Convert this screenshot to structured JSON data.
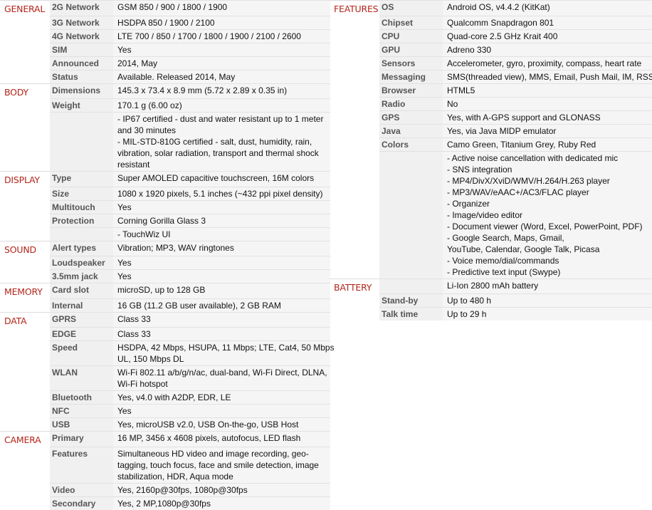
{
  "left": [
    {
      "category": "GENERAL",
      "rows": [
        {
          "name": "2G Network",
          "value": [
            "GSM 850 / 900 / 1800 / 1900"
          ]
        },
        {
          "name": "3G Network",
          "value": [
            "HSDPA 850 / 1900 / 2100"
          ]
        },
        {
          "name": "4G Network",
          "value": [
            "LTE 700 / 850 / 1700 / 1800 / 1900 / 2100 / 2600"
          ]
        },
        {
          "name": "SIM",
          "value": [
            "Yes"
          ]
        },
        {
          "name": "Announced",
          "value": [
            "2014, May"
          ]
        },
        {
          "name": "Status",
          "value": [
            "Available. Released 2014, May"
          ]
        }
      ]
    },
    {
      "category": "BODY",
      "rows": [
        {
          "name": "Dimensions",
          "value": [
            "145.3 x 73.4 x 8.9 mm (5.72 x 2.89 x 0.35 in)"
          ]
        },
        {
          "name": "Weight",
          "value": [
            "170.1 g (6.00 oz)"
          ]
        },
        {
          "name": "",
          "value": [
            "- IP67 certified - dust and water resistant up to 1 meter",
            "and 30 minutes",
            "- MIL-STD-810G certified - salt, dust, humidity, rain,",
            "vibration, solar radiation, transport and thermal shock",
            "resistant"
          ]
        }
      ]
    },
    {
      "category": "DISPLAY",
      "rows": [
        {
          "name": "Type",
          "value": [
            "Super AMOLED capacitive touchscreen, 16M colors"
          ]
        },
        {
          "name": "Size",
          "value": [
            "1080 x 1920 pixels, 5.1 inches (~432 ppi pixel density)"
          ]
        },
        {
          "name": "Multitouch",
          "value": [
            "Yes"
          ]
        },
        {
          "name": "Protection",
          "value": [
            "Corning Gorilla Glass 3"
          ]
        },
        {
          "name": "",
          "value": [
            "- TouchWiz UI"
          ]
        }
      ]
    },
    {
      "category": "SOUND",
      "rows": [
        {
          "name": "Alert types",
          "value": [
            "Vibration; MP3, WAV ringtones"
          ]
        },
        {
          "name": "Loudspeaker",
          "value": [
            "Yes"
          ]
        },
        {
          "name": "3.5mm jack",
          "value": [
            "Yes"
          ]
        }
      ]
    },
    {
      "category": "MEMORY",
      "rows": [
        {
          "name": "Card slot",
          "value": [
            "microSD, up to 128 GB"
          ]
        },
        {
          "name": "Internal",
          "value": [
            "16 GB (11.2 GB user available), 2 GB RAM"
          ]
        }
      ]
    },
    {
      "category": "DATA",
      "rows": [
        {
          "name": "GPRS",
          "value": [
            "Class 33"
          ]
        },
        {
          "name": "EDGE",
          "value": [
            "Class 33"
          ]
        },
        {
          "name": "Speed",
          "value": [
            "HSDPA, 42 Mbps, HSUPA, 11 Mbps; LTE, Cat4, 50 Mbps",
            "UL, 150 Mbps DL"
          ]
        },
        {
          "name": "WLAN",
          "value": [
            "Wi-Fi 802.11 a/b/g/n/ac, dual-band, Wi-Fi Direct, DLNA,",
            "Wi-Fi hotspot"
          ]
        },
        {
          "name": "Bluetooth",
          "value": [
            "Yes, v4.0 with A2DP, EDR, LE"
          ]
        },
        {
          "name": "NFC",
          "value": [
            "Yes"
          ]
        },
        {
          "name": "USB",
          "value": [
            "Yes, microUSB v2.0, USB On-the-go, USB Host"
          ]
        }
      ]
    },
    {
      "category": "CAMERA",
      "rows": [
        {
          "name": "Primary",
          "value": [
            "16 MP, 3456 x 4608 pixels, autofocus, LED flash"
          ]
        },
        {
          "name": "Features",
          "value": [
            "Simultaneous HD video and image recording, geo-",
            "tagging, touch focus, face and smile detection, image",
            "stabilization, HDR, Aqua mode"
          ]
        },
        {
          "name": "Video",
          "value": [
            "Yes, 2160p@30fps, 1080p@30fps"
          ]
        },
        {
          "name": "Secondary",
          "value": [
            "Yes, 2 MP,1080p@30fps"
          ]
        }
      ]
    }
  ],
  "right": [
    {
      "category": "FEATURES",
      "rows": [
        {
          "name": "OS",
          "value": [
            "Android OS, v4.4.2 (KitKat)"
          ]
        },
        {
          "name": "Chipset",
          "value": [
            "Qualcomm Snapdragon 801"
          ]
        },
        {
          "name": "CPU",
          "value": [
            "Quad-core 2.5 GHz Krait 400"
          ]
        },
        {
          "name": "GPU",
          "value": [
            "Adreno 330"
          ]
        },
        {
          "name": "Sensors",
          "value": [
            "Accelerometer, gyro, proximity, compass, heart rate"
          ]
        },
        {
          "name": "Messaging",
          "value": [
            "SMS(threaded view), MMS, Email, Push Mail, IM, RSS"
          ]
        },
        {
          "name": "Browser",
          "value": [
            "HTML5"
          ]
        },
        {
          "name": "Radio",
          "value": [
            "No"
          ]
        },
        {
          "name": "GPS",
          "value": [
            "Yes, with A-GPS support and GLONASS"
          ]
        },
        {
          "name": "Java",
          "value": [
            "Yes, via Java MIDP emulator"
          ]
        },
        {
          "name": "Colors",
          "value": [
            "Camo Green, Titanium Grey, Ruby Red"
          ]
        },
        {
          "name": "",
          "value": [
            "- Active noise cancellation with dedicated mic",
            "- SNS integration",
            "- MP4/DivX/XviD/WMV/H.264/H.263 player",
            "- MP3/WAV/eAAC+/AC3/FLAC player",
            "- Organizer",
            "- Image/video editor",
            "- Document viewer (Word, Excel, PowerPoint, PDF)",
            "- Google Search, Maps, Gmail,",
            "YouTube, Calendar, Google Talk, Picasa",
            "- Voice memo/dial/commands",
            "- Predictive text input (Swype)"
          ]
        }
      ]
    },
    {
      "category": "BATTERY",
      "rows": [
        {
          "name": "",
          "value": [
            "Li-Ion 2800 mAh battery"
          ]
        },
        {
          "name": "Stand-by",
          "value": [
            "Up to 480 h"
          ]
        },
        {
          "name": "Talk time",
          "value": [
            "Up to 29 h"
          ]
        }
      ]
    }
  ]
}
